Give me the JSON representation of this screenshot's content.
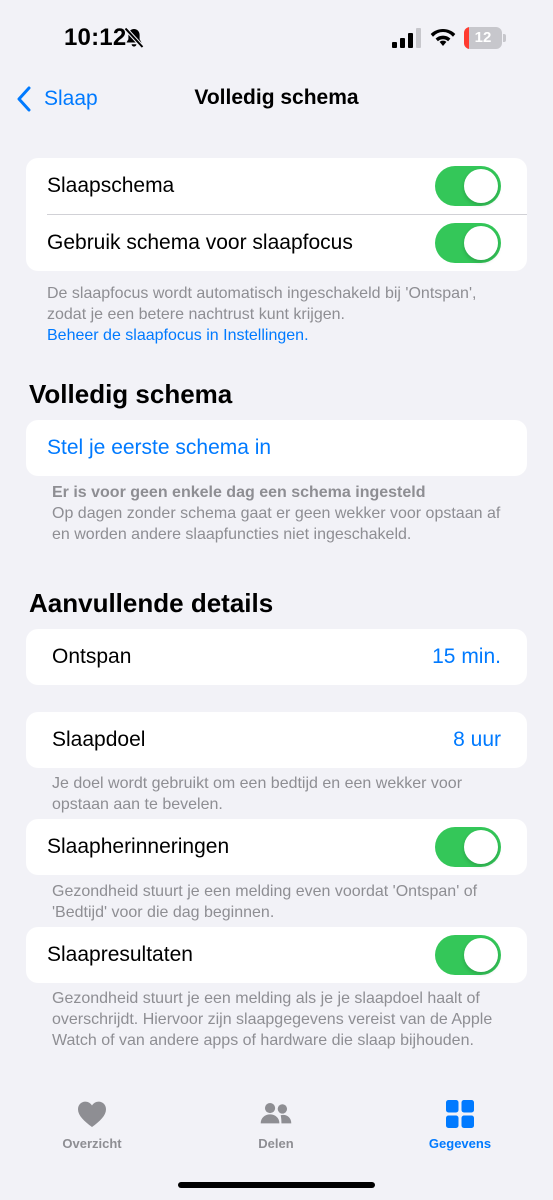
{
  "status_bar": {
    "time": "10:12",
    "battery_level": "12",
    "battery_fraction": 0.12,
    "icons": [
      "bell-slash-icon",
      "cellular-signal-icon",
      "wifi-icon",
      "battery-icon"
    ]
  },
  "nav": {
    "back_label": "Slaap",
    "title": "Volledig schema"
  },
  "sleep_settings": {
    "sleep_schedule_label": "Slaapschema",
    "sleep_schedule_on": true,
    "use_schedule_focus_label": "Gebruik schema voor slaapfocus",
    "use_schedule_focus_on": true,
    "footnote": "De slaapfocus wordt automatisch ingeschakeld bij 'Ontspan', zodat je een betere nachtrust kunt krijgen.",
    "footnote_link": "Beheer de slaapfocus in Instellingen."
  },
  "full_schedule": {
    "header": "Volledig schema",
    "setup_link": "Stel je eerste schema in",
    "notice_title": "Er is voor geen enkele dag een schema ingesteld",
    "notice_body": "Op dagen zonder schema gaat er geen wekker voor opstaan af en worden andere slaapfuncties niet ingeschakeld."
  },
  "additional_details": {
    "header": "Aanvullende details",
    "wind_down_label": "Ontspan",
    "wind_down_value": "15 min.",
    "sleep_goal_label": "Slaapdoel",
    "sleep_goal_value": "8 uur",
    "sleep_goal_footnote": "Je doel wordt gebruikt om een bedtijd en een wekker voor opstaan aan te bevelen.",
    "reminders_label": "Slaapherinneringen",
    "reminders_on": true,
    "reminders_footnote": "Gezondheid stuurt je een melding even voordat 'Ontspan' of 'Bedtijd' voor die dag beginnen.",
    "results_label": "Slaapresultaten",
    "results_on": true,
    "results_footnote": "Gezondheid stuurt je een melding als je je slaapdoel haalt of overschrijdt. Hiervoor zijn slaapgegevens vereist van de Apple Watch of van andere apps of hardware die slaap bijhouden."
  },
  "tab_bar": {
    "tabs": [
      {
        "label": "Overzicht",
        "icon": "heart-icon",
        "active": false
      },
      {
        "label": "Delen",
        "icon": "people-icon",
        "active": false
      },
      {
        "label": "Gegevens",
        "icon": "grid-icon",
        "active": true
      }
    ]
  },
  "colors": {
    "accent": "#007aff",
    "toggle_on": "#34c759",
    "background": "#f2f2f7",
    "secondary_text": "#8e8e93",
    "battery_low": "#ff3b30"
  }
}
